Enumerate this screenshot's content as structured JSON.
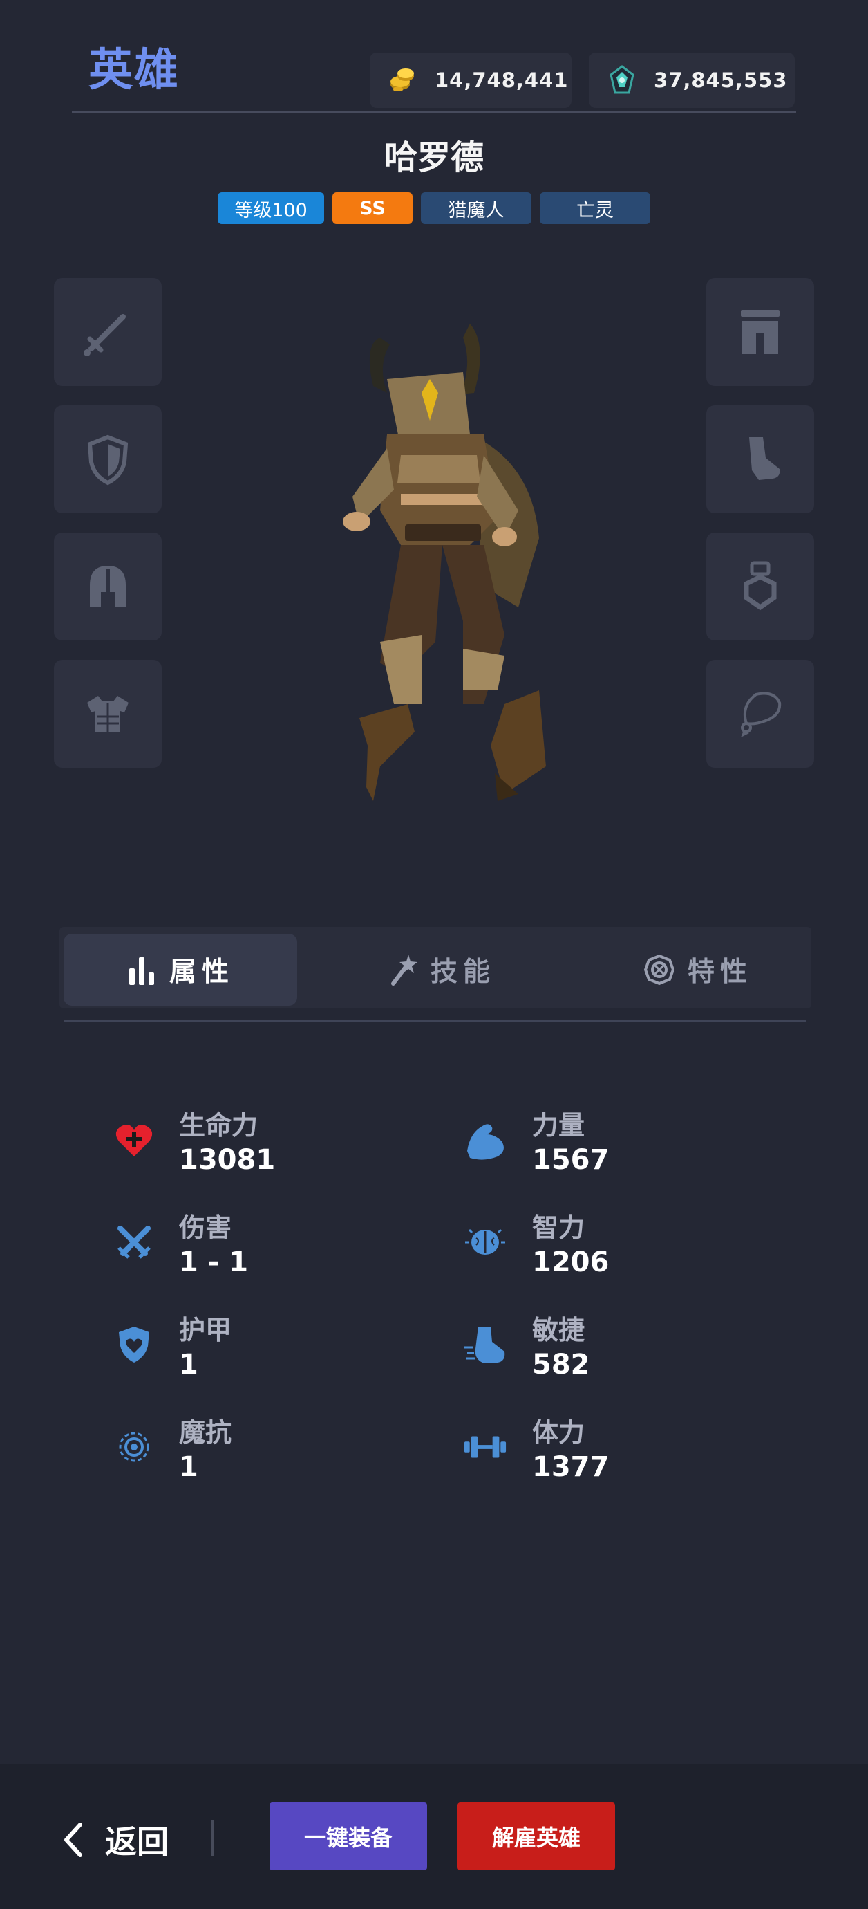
{
  "header": {
    "title": "英雄",
    "gold": "14,748,441",
    "gem": "37,845,553"
  },
  "hero": {
    "name": "哈罗德",
    "tags": [
      {
        "text": "等级100",
        "color": "#1a86d8"
      },
      {
        "text": "SS",
        "color": "#f47a10"
      },
      {
        "text": "猎魔人",
        "color": "#2a4a73"
      },
      {
        "text": "亡灵",
        "color": "#2a4a73"
      }
    ]
  },
  "equipment": {
    "left": [
      "sword-icon",
      "shield-icon",
      "helmet-icon",
      "armor-icon"
    ],
    "right": [
      "pants-icon",
      "boot-icon",
      "ring-icon",
      "necklace-icon"
    ]
  },
  "tabs": [
    {
      "label": "属性",
      "icon": "bar-chart-icon",
      "active": true
    },
    {
      "label": "技能",
      "icon": "magic-wand-icon",
      "active": false
    },
    {
      "label": "特性",
      "icon": "trait-badge-icon",
      "active": false
    }
  ],
  "stats": {
    "left": [
      {
        "label": "生命力",
        "value": "13081",
        "icon": "heart-plus-icon"
      },
      {
        "label": "伤害",
        "value": "1 - 1",
        "icon": "crossed-swords-icon"
      },
      {
        "label": "护甲",
        "value": "1",
        "icon": "shield-heart-icon"
      },
      {
        "label": "魔抗",
        "value": "1",
        "icon": "magic-swirl-icon"
      }
    ],
    "right": [
      {
        "label": "力量",
        "value": "1567",
        "icon": "muscle-icon"
      },
      {
        "label": "智力",
        "value": "1206",
        "icon": "brain-icon"
      },
      {
        "label": "敏捷",
        "value": "582",
        "icon": "running-shoe-icon"
      },
      {
        "label": "体力",
        "value": "1377",
        "icon": "dumbbell-icon"
      }
    ]
  },
  "footer": {
    "back_label": "返回",
    "equip_label": "一键装备",
    "dismiss_label": "解雇英雄"
  }
}
